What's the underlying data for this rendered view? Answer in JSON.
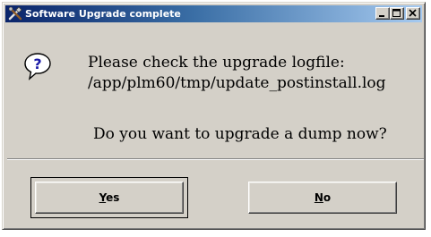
{
  "window": {
    "title": "Software Upgrade complete",
    "icon": "tools-icon",
    "controls": [
      "minimize-icon",
      "maximize-icon",
      "close-icon"
    ]
  },
  "dialog": {
    "icon": "question-icon",
    "message_line1": "Please check the upgrade logfile:",
    "message_line2": "/app/plm60/tmp/update_postinstall.log",
    "question": "Do you want to upgrade a dump now?"
  },
  "buttons": {
    "yes": {
      "mnemonic": "Y",
      "rest": "es"
    },
    "no": {
      "mnemonic": "N",
      "rest": "o"
    }
  },
  "colors": {
    "titlebar_start": "#0a246a",
    "titlebar_end": "#a6caf0",
    "face": "#d4d0c8",
    "icon_blue": "#1a1aa6"
  }
}
